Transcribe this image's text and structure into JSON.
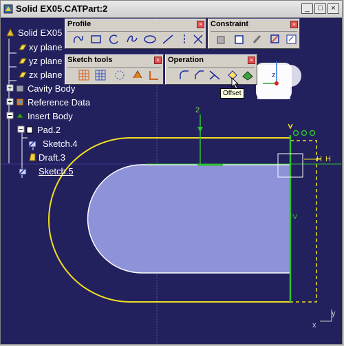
{
  "window": {
    "title": "Solid EX05.CATPart:2",
    "minimize_symbol": "_",
    "maximize_symbol": "□",
    "close_symbol": "×"
  },
  "tree": {
    "root": "Solid EX05",
    "items": [
      {
        "label": "xy plane"
      },
      {
        "label": "yz plane"
      },
      {
        "label": "zx plane"
      },
      {
        "label": "Cavity Body"
      },
      {
        "label": "Reference Data"
      },
      {
        "label": "Insert Body"
      },
      {
        "label": "Pad.2"
      },
      {
        "label": "Sketch.4"
      },
      {
        "label": "Draft.3"
      },
      {
        "label": "Sketch.5"
      }
    ]
  },
  "toolbars": {
    "profile": {
      "title": "Profile"
    },
    "constraint": {
      "title": "Constraint"
    },
    "sketch_tools": {
      "title": "Sketch tools"
    },
    "operation": {
      "title": "Operation"
    }
  },
  "tooltip": "Offset",
  "dimension": "2",
  "axis_labels": {
    "h": "H",
    "v": "V",
    "compass_z": "z",
    "corner_x": "x",
    "corner_y": "y"
  },
  "colors": {
    "background": "#23205e",
    "profile_yellow": "#f0e020",
    "fill_blue": "#8e92d8",
    "constraint_green": "#30c030"
  }
}
